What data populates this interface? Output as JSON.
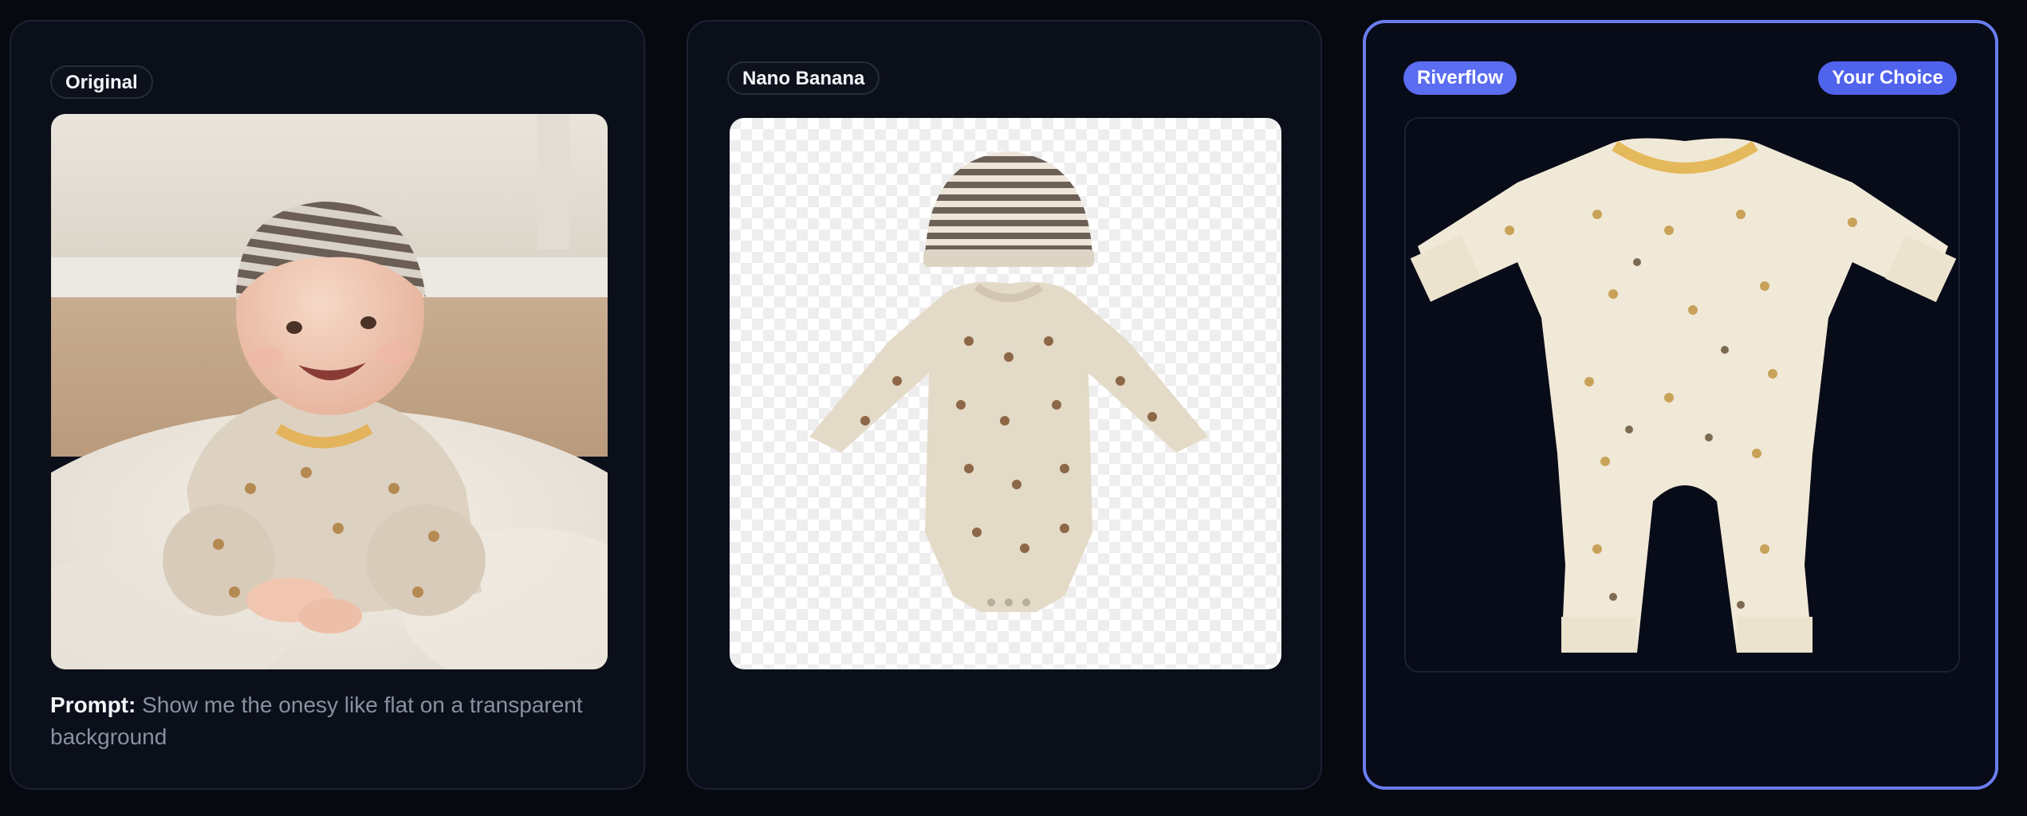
{
  "cards": [
    {
      "badge": "Original",
      "image_alt": "Smiling baby wearing a striped beanie and a patterned onesie lying on a fluffy rug",
      "prompt_label": "Prompt:",
      "prompt_text": "Show me the onesy like flat on a transparent background"
    },
    {
      "badge": "Nano Banana",
      "image_alt": "Striped beanie and long-sleeve bodysuit on a transparent checkerboard background"
    },
    {
      "badge": "Riverflow",
      "choice_badge": "Your Choice",
      "image_alt": "Cream long-sleeve footless romper laid flat on a dark background"
    }
  ],
  "colors": {
    "selected_border": "#6a7df0",
    "accent_badge": "#5b6df0"
  }
}
